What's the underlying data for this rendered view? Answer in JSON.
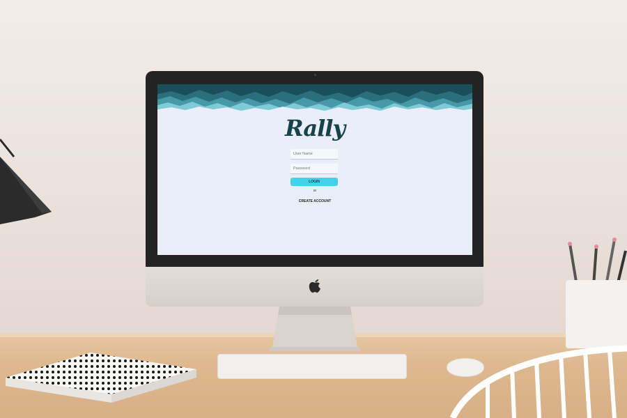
{
  "app": {
    "logo": "Rally"
  },
  "login_form": {
    "username_placeholder": "User Name",
    "password_placeholder": "Password",
    "login_label": "LOGIN",
    "or_label": "or",
    "create_account_label": "CREATE ACCOUNT"
  },
  "colors": {
    "screen_background": "#e9eef8",
    "logo_color": "#17424a",
    "login_button": "#44d2eb",
    "banner_dark": "#1c5560",
    "banner_mid": "#3f93a3",
    "banner_light": "#7fcad6"
  },
  "icons": [
    "apple-logo-icon"
  ]
}
